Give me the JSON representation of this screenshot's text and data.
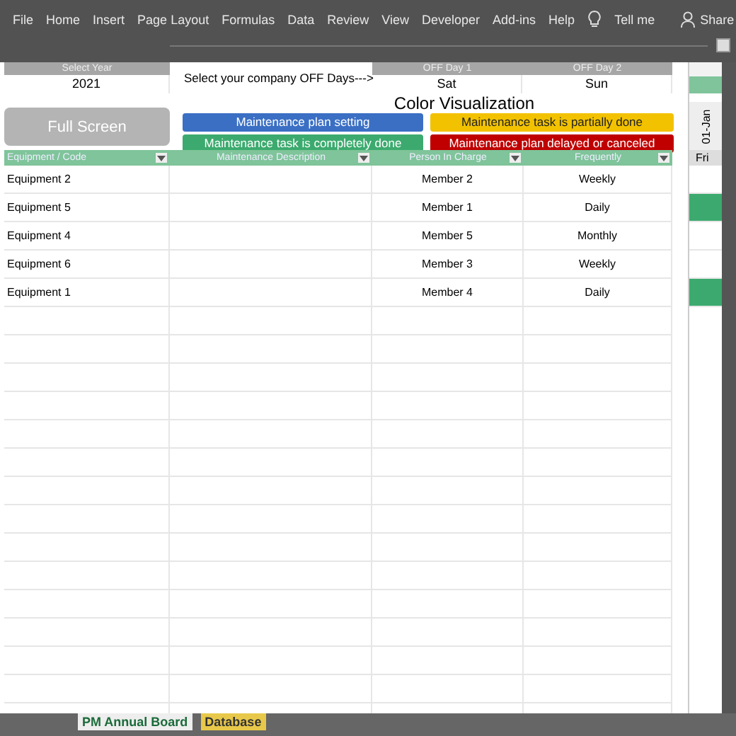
{
  "menu": [
    "File",
    "Home",
    "Insert",
    "Page Layout",
    "Formulas",
    "Data",
    "Review",
    "View",
    "Developer",
    "Add-ins",
    "Help"
  ],
  "tell_me": "Tell me",
  "share": "Share",
  "year": {
    "label": "Select Year",
    "value": "2021"
  },
  "off_days_prompt": "Select your company  OFF Days--->",
  "off_days": [
    {
      "label": "OFF Day 1",
      "value": "Sat"
    },
    {
      "label": "OFF Day 2",
      "value": "Sun"
    }
  ],
  "legend_title": "Color Visualization",
  "full_screen_button": "Full Screen",
  "legend": [
    {
      "label": "Maintenance plan setting",
      "color": "#3a6fc4"
    },
    {
      "label": "Maintenance task is partially done",
      "color": "#f2c200"
    },
    {
      "label": "Maintenance task is completely done",
      "color": "#3caa6e"
    },
    {
      "label": "Maintenance plan delayed or canceled",
      "color": "#c00000"
    }
  ],
  "table": {
    "columns": [
      "Equipment / Code",
      "Maintenance Description",
      "Person In Charge",
      "Frequently"
    ],
    "rows": [
      {
        "cells": [
          "Equipment 2",
          "",
          "Member 2",
          "Weekly"
        ],
        "calendar_marked": false
      },
      {
        "cells": [
          "Equipment 5",
          "",
          "Member 1",
          "Daily"
        ],
        "calendar_marked": true
      },
      {
        "cells": [
          "Equipment 4",
          "",
          "Member 5",
          "Monthly"
        ],
        "calendar_marked": false
      },
      {
        "cells": [
          "Equipment 6",
          "",
          "Member 3",
          "Weekly"
        ],
        "calendar_marked": false
      },
      {
        "cells": [
          "Equipment 1",
          "",
          "Member 4",
          "Daily"
        ],
        "calendar_marked": true
      }
    ]
  },
  "calendar": {
    "date": "01-Jan",
    "weekday": "Fri"
  },
  "sheet_tabs": [
    {
      "label": "PM Annual Board",
      "selected": true
    },
    {
      "label": "Database",
      "selected": false
    }
  ]
}
